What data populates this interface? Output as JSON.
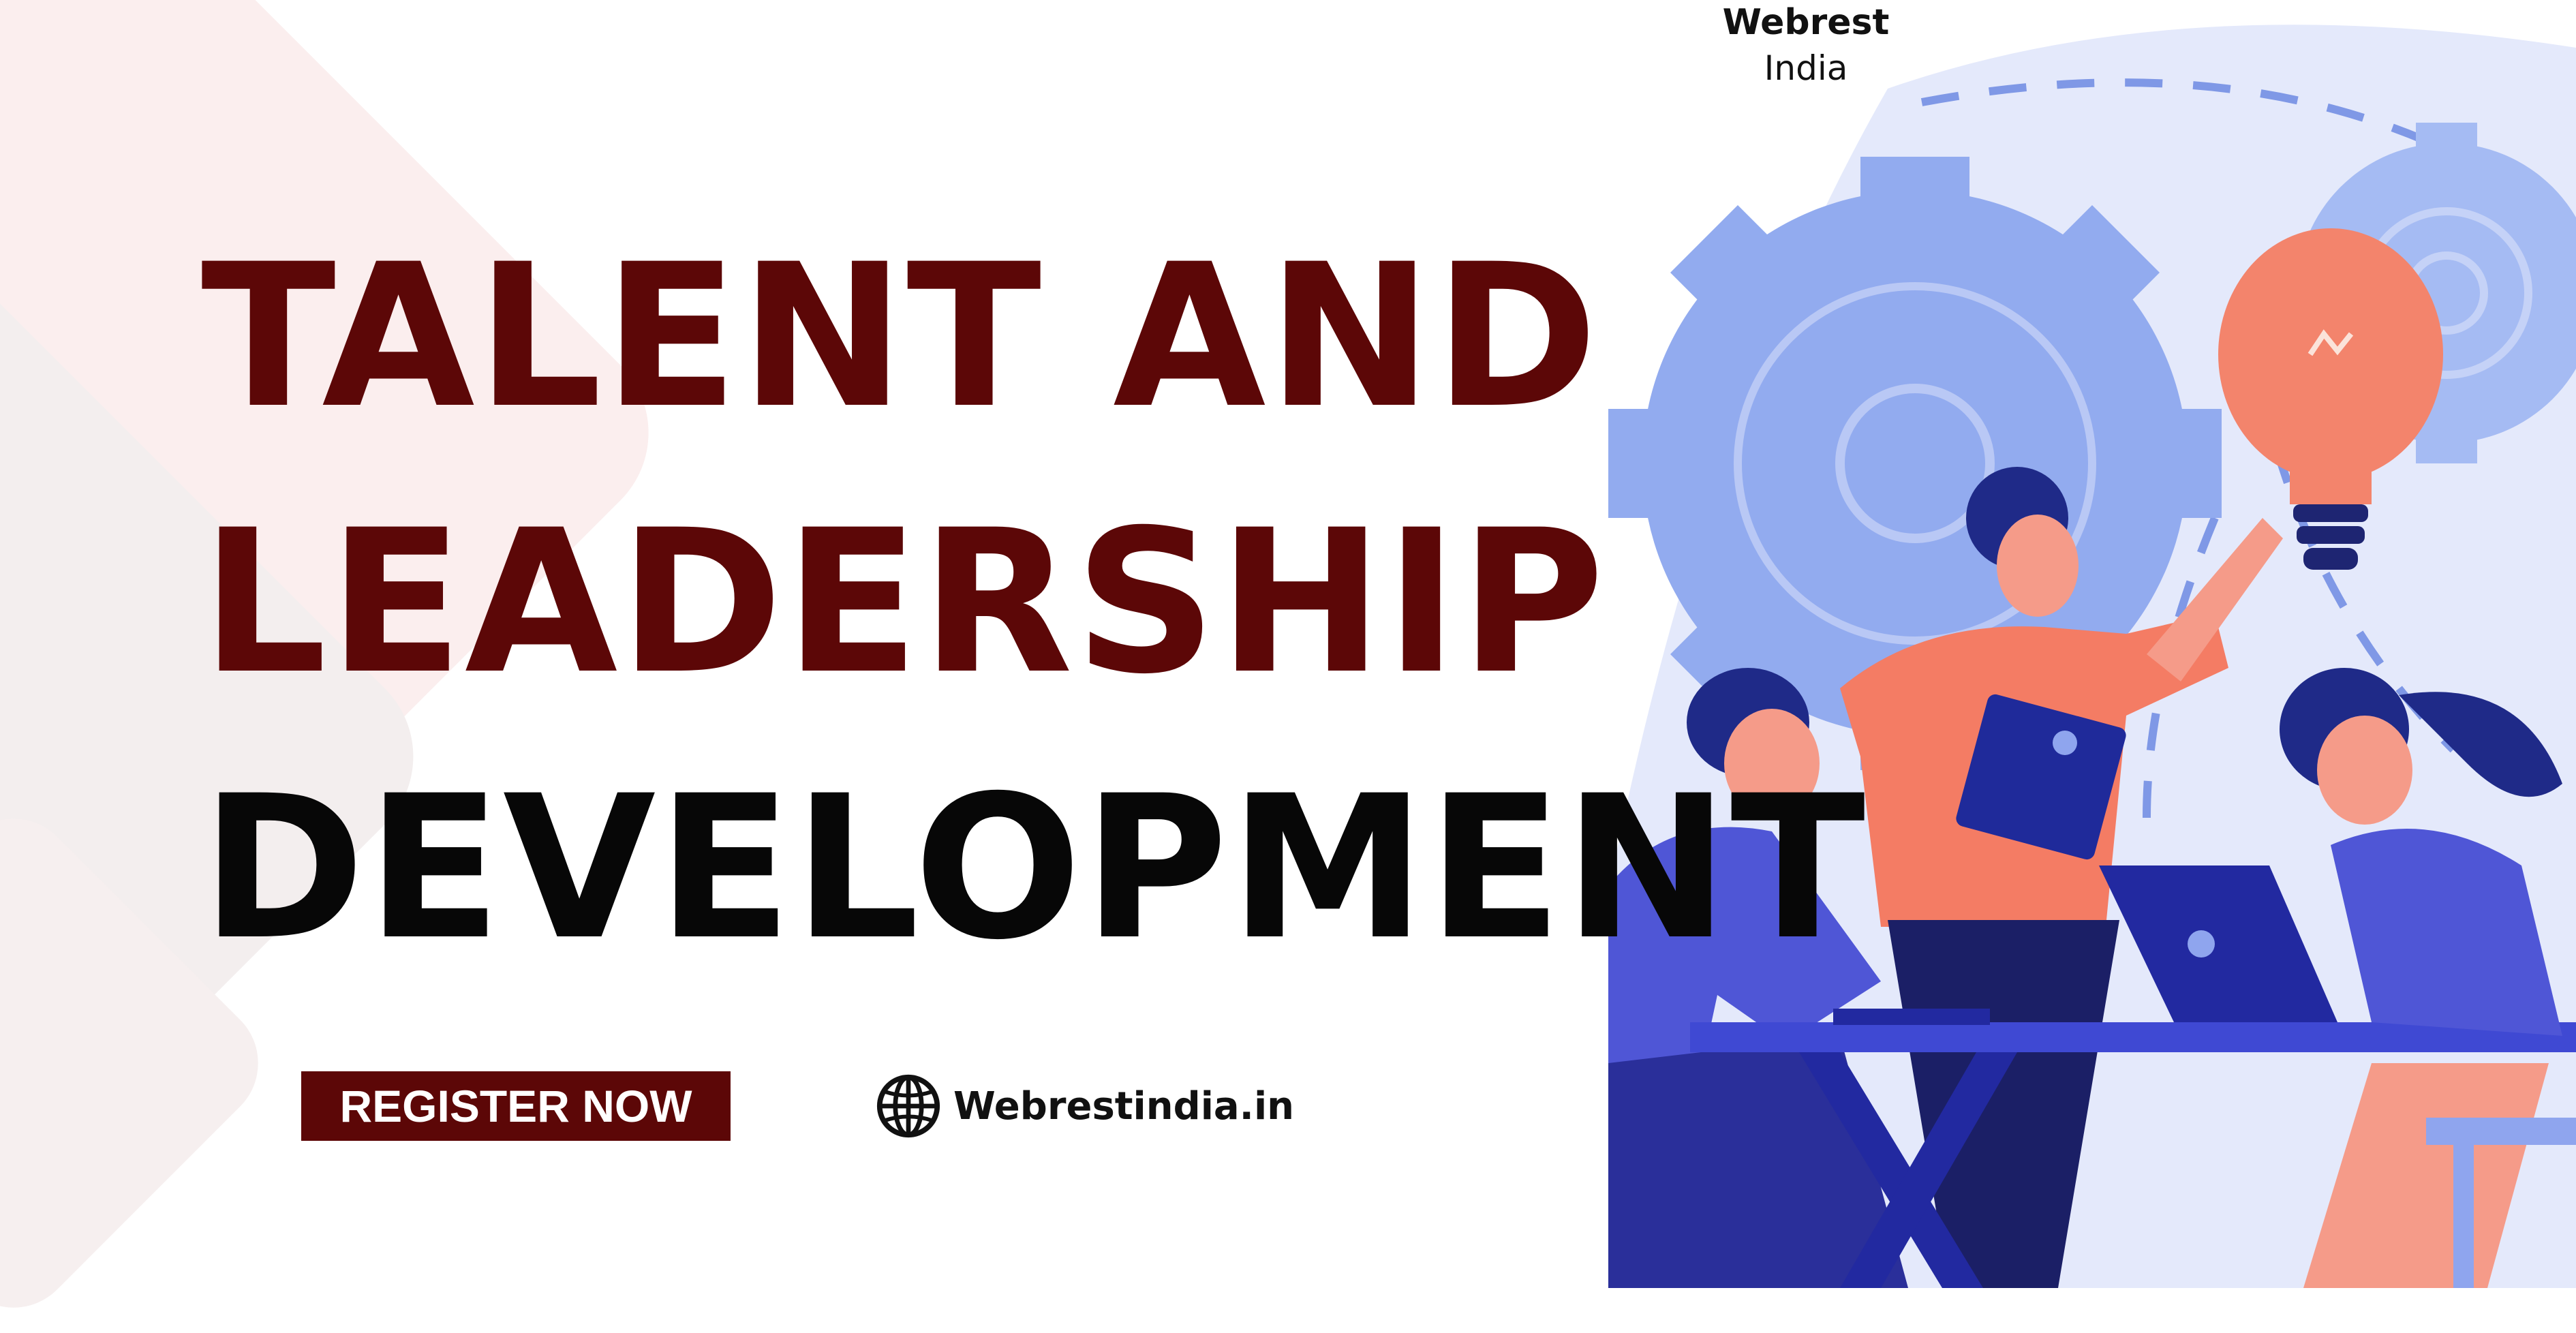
{
  "brand": {
    "name": "Webrest",
    "subtitle": "India"
  },
  "headline": {
    "line1": "TALENT AND",
    "line2": "LEADERSHIP",
    "line3": "DEVELOPMENT"
  },
  "cta": {
    "label": "REGISTER NOW"
  },
  "website": {
    "icon": "globe-icon",
    "url": "Webrestindia.in"
  },
  "colors": {
    "accent": "#5c0707",
    "text": "#070707",
    "illustration_blue": "#4f56d6",
    "illustration_orange": "#f47c64"
  }
}
